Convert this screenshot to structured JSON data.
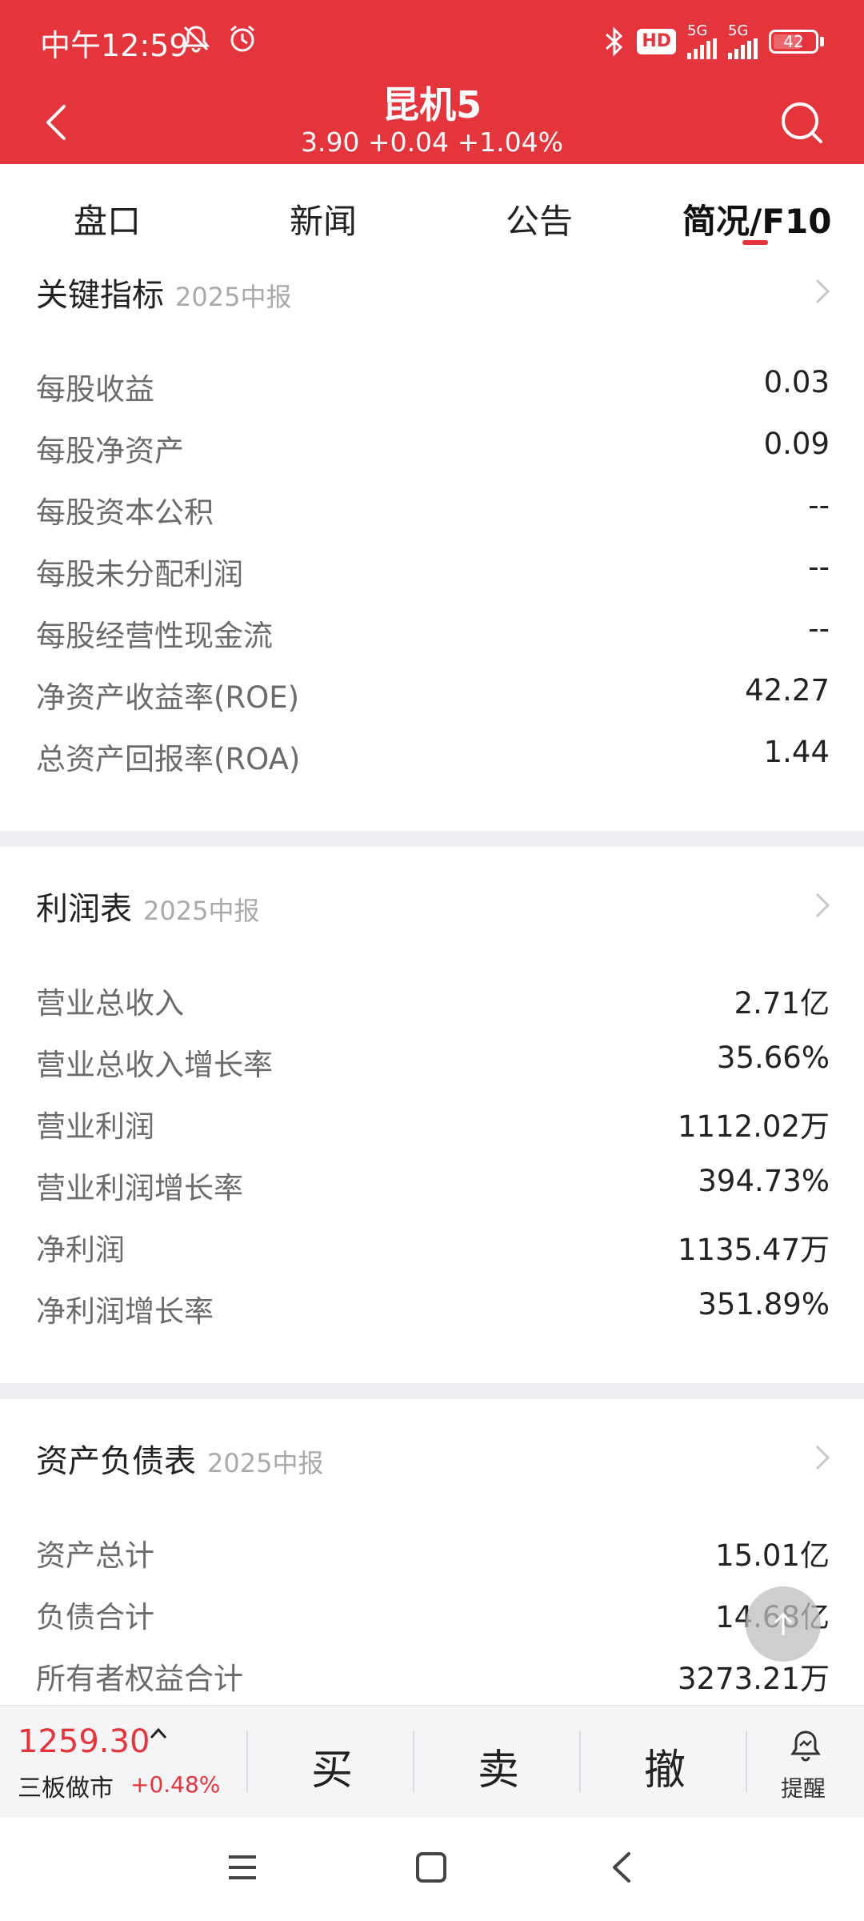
{
  "status_bar": {
    "time": "中午12:59",
    "hd": "HD",
    "network_1": "5G",
    "network_2": "5G",
    "battery": "42"
  },
  "header": {
    "title": "昆机5",
    "quote": "3.90  +0.04  +1.04%"
  },
  "tabs": [
    {
      "label": "盘口",
      "active": false
    },
    {
      "label": "新闻",
      "active": false
    },
    {
      "label": "公告",
      "active": false
    },
    {
      "label": "简况/F10",
      "active": true
    }
  ],
  "key_indicators": {
    "title": "关键指标",
    "period": "2025中报",
    "rows": [
      {
        "label": "每股收益",
        "value": "0.03"
      },
      {
        "label": "每股净资产",
        "value": "0.09"
      },
      {
        "label": "每股资本公积",
        "value": "--"
      },
      {
        "label": "每股未分配利润",
        "value": "--"
      },
      {
        "label": "每股经营性现金流",
        "value": "--"
      },
      {
        "label": "净资产收益率(ROE)",
        "value": "42.27"
      },
      {
        "label": "总资产回报率(ROA)",
        "value": "1.44"
      }
    ]
  },
  "income_statement": {
    "title": "利润表",
    "period": "2025中报",
    "rows": [
      {
        "label": "营业总收入",
        "value": "2.71亿"
      },
      {
        "label": "营业总收入增长率",
        "value": "35.66%"
      },
      {
        "label": "营业利润",
        "value": "1112.02万"
      },
      {
        "label": "营业利润增长率",
        "value": "394.73%"
      },
      {
        "label": "净利润",
        "value": "1135.47万"
      },
      {
        "label": "净利润增长率",
        "value": "351.89%"
      }
    ]
  },
  "balance_sheet": {
    "title": "资产负债表",
    "period": "2025中报",
    "rows": [
      {
        "label": "资产总计",
        "value": "15.01亿"
      },
      {
        "label": "负债合计",
        "value": "14.68亿"
      },
      {
        "label": "所有者权益合计",
        "value": "3273.21万"
      }
    ]
  },
  "trade_bar": {
    "index_value": "1259.30",
    "index_name": "三板做市",
    "index_change": "+0.48%",
    "buy": "买",
    "sell": "卖",
    "cancel": "撤",
    "remind": "提醒"
  },
  "colors": {
    "brand_red": "#e5353c",
    "label_gray": "#6b6b6b",
    "period_gray": "#aaaaaa",
    "divider": "#efeff3"
  },
  "icons": [
    "back-icon",
    "search-icon",
    "chevron-right-icon",
    "bell-icon",
    "menu-icon",
    "home-square-icon",
    "back-triangle-icon",
    "arrow-up-icon",
    "bluetooth-icon",
    "mute-bell-icon",
    "alarm-icon"
  ]
}
